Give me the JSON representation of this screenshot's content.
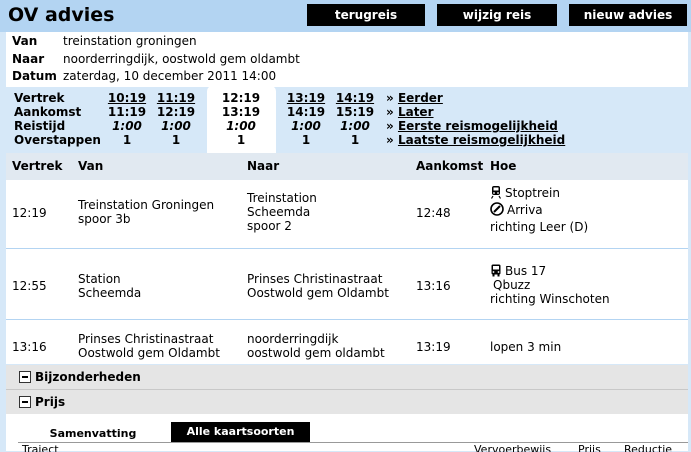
{
  "header": {
    "title": "OV advies"
  },
  "top_buttons": {
    "back": "terugreis",
    "change": "wijzig reis",
    "new": "nieuw advies"
  },
  "info": {
    "van_label": "Van",
    "van": "treinstation groningen",
    "naar_label": "Naar",
    "naar": "noorderringdijk, oostwold gem oldambt",
    "datum_label": "Datum",
    "datum": "zaterdag, 10 december 2011  14:00"
  },
  "options": {
    "labels": [
      "Vertrek",
      "Aankomst",
      "Reistijd",
      "Overstappen"
    ],
    "columns": [
      {
        "vertrek": "10:19",
        "aankomst": "11:19",
        "reistijd": "1:00",
        "overstappen": "1"
      },
      {
        "vertrek": "11:19",
        "aankomst": "12:19",
        "reistijd": "1:00",
        "overstappen": "1"
      },
      {
        "vertrek": "12:19",
        "aankomst": "13:19",
        "reistijd": "1:00",
        "overstappen": "1"
      },
      {
        "vertrek": "13:19",
        "aankomst": "14:19",
        "reistijd": "1:00",
        "overstappen": "1"
      },
      {
        "vertrek": "14:19",
        "aankomst": "15:19",
        "reistijd": "1:00",
        "overstappen": "1"
      }
    ],
    "selected_index": 2,
    "nav": [
      "Eerder",
      "Later",
      "Eerste reismogelijkheid",
      "Laatste reismogelijkheid"
    ],
    "nav_prefix": "»"
  },
  "table": {
    "headers": {
      "vertrek": "Vertrek",
      "van": "Van",
      "naar": "Naar",
      "aankomst": "Aankomst",
      "hoe": "Hoe"
    },
    "rows": [
      {
        "vertrek": "12:19",
        "van1": "Treinstation Groningen",
        "van2": "spoor 3b",
        "naar1": "Treinstation",
        "naar2": "Scheemda",
        "naar3": "spoor 2",
        "aankomst": "12:48",
        "hoe1": "Stoptrein",
        "hoe2": "Arriva",
        "hoe3": "richting Leer (D)",
        "icon1": "train-icon",
        "icon2": "arriva-logo-icon"
      },
      {
        "vertrek": "12:55",
        "van1": "Station",
        "van2": "Scheemda",
        "naar1": "Prinses Christinastraat",
        "naar2": "Oostwold gem Oldambt",
        "aankomst": "13:16",
        "hoe1": "Bus 17",
        "hoe2": "Qbuzz",
        "hoe3": "richting Winschoten",
        "icon1": "bus-icon"
      },
      {
        "vertrek": "13:16",
        "van1": "Prinses Christinastraat",
        "van2": "Oostwold gem Oldambt",
        "naar1": "noorderringdijk",
        "naar2": "oostwold gem oldambt",
        "aankomst": "13:19",
        "hoe1": "lopen 3 min"
      }
    ]
  },
  "sections": {
    "details": "Bijzonderheden",
    "price": "Prijs"
  },
  "price": {
    "tabs": [
      "Samenvatting",
      "Alle kaartsoorten"
    ],
    "active_tab": 1,
    "columns": [
      "Traject",
      "Vervoerbewijs",
      "Prijs",
      "Reductie"
    ]
  }
}
